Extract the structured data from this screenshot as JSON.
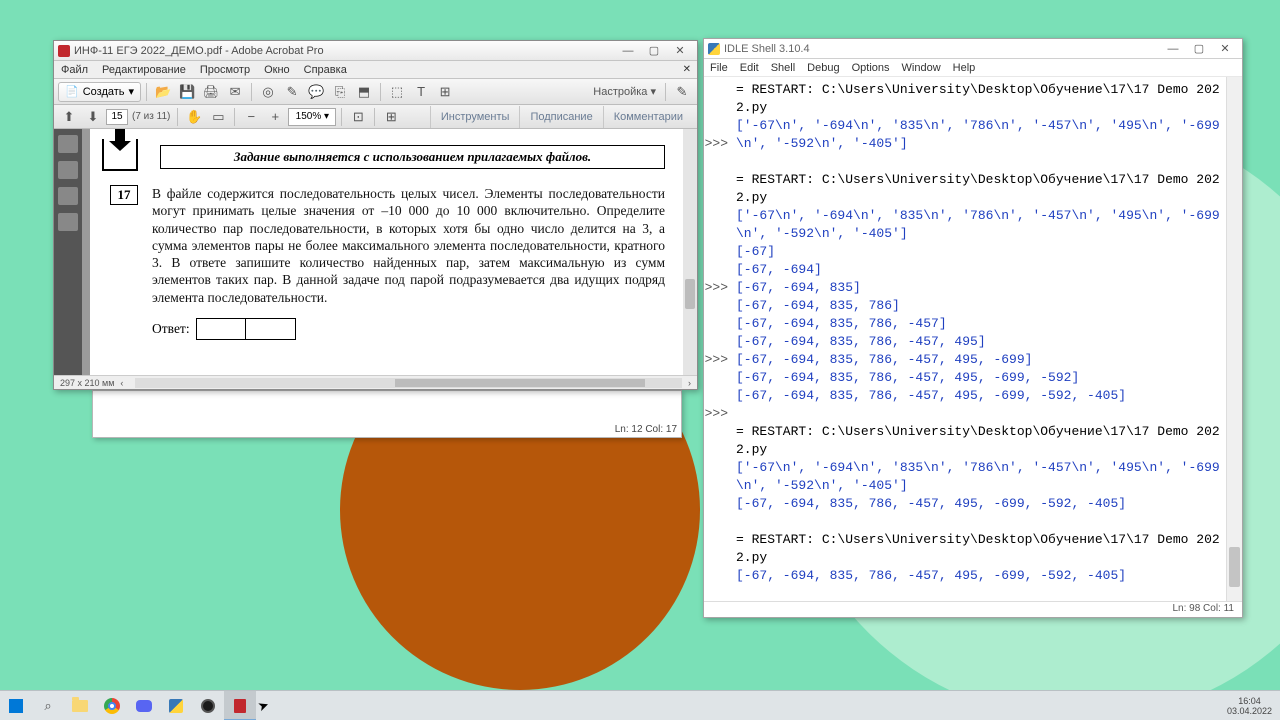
{
  "acrobat": {
    "title": "ИНФ-11 ЕГЭ 2022_ДЕМО.pdf - Adobe Acrobat Pro",
    "menu": [
      "Файл",
      "Редактирование",
      "Просмотр",
      "Окно",
      "Справка"
    ],
    "create_label": "Создать",
    "settings_label": "Настройка",
    "page_current": "15",
    "page_total": "(7 из 11)",
    "zoom": "150%",
    "right_tabs": [
      "Инструменты",
      "Подписание",
      "Комментарии"
    ],
    "banner": "Задание выполняется с использованием прилагаемых файлов.",
    "task_num": "17",
    "task_text": "В файле содержится последовательность целых чисел. Элементы последовательности могут принимать целые значения от –10 000 до 10 000 включительно. Определите количество пар последовательности, в которых хотя бы одно число делится на 3, а сумма элементов пары не более максимального элемента последовательности, кратного 3. В ответе запишите количество найденных пар, затем максимальную из сумм элементов таких пар. В данной задаче под парой подразумевается два идущих подряд элемента последовательности.",
    "answer_label": "Ответ:",
    "status_dim": "297 x 210 мм",
    "shell_status": "Ln: 12   Col: 17"
  },
  "idle": {
    "title": "IDLE Shell 3.10.4",
    "menu": [
      "File",
      "Edit",
      "Shell",
      "Debug",
      "Options",
      "Window",
      "Help"
    ],
    "restart": "= RESTART: C:\\Users\\University\\Desktop\\Обучение\\17\\17 Demo 2022.py",
    "raw_list": "['-67\\n', '-694\\n', '835\\n', '786\\n', '-457\\n', '495\\n', '-699\\n', '-592\\n', '-405']",
    "grow": [
      "[-67]",
      "[-67, -694]",
      "[-67, -694, 835]",
      "[-67, -694, 835, 786]",
      "[-67, -694, 835, 786, -457]",
      "[-67, -694, 835, 786, -457, 495]",
      "[-67, -694, 835, 786, -457, 495, -699]",
      "[-67, -694, 835, 786, -457, 495, -699, -592]",
      "[-67, -694, 835, 786, -457, 495, -699, -592, -405]"
    ],
    "final": "[-67, -694, 835, 786, -457, 495, -699, -592, -405]",
    "status": "Ln: 98   Col: 11"
  },
  "taskbar": {
    "time": "16:04",
    "date": "03.04.2022"
  }
}
